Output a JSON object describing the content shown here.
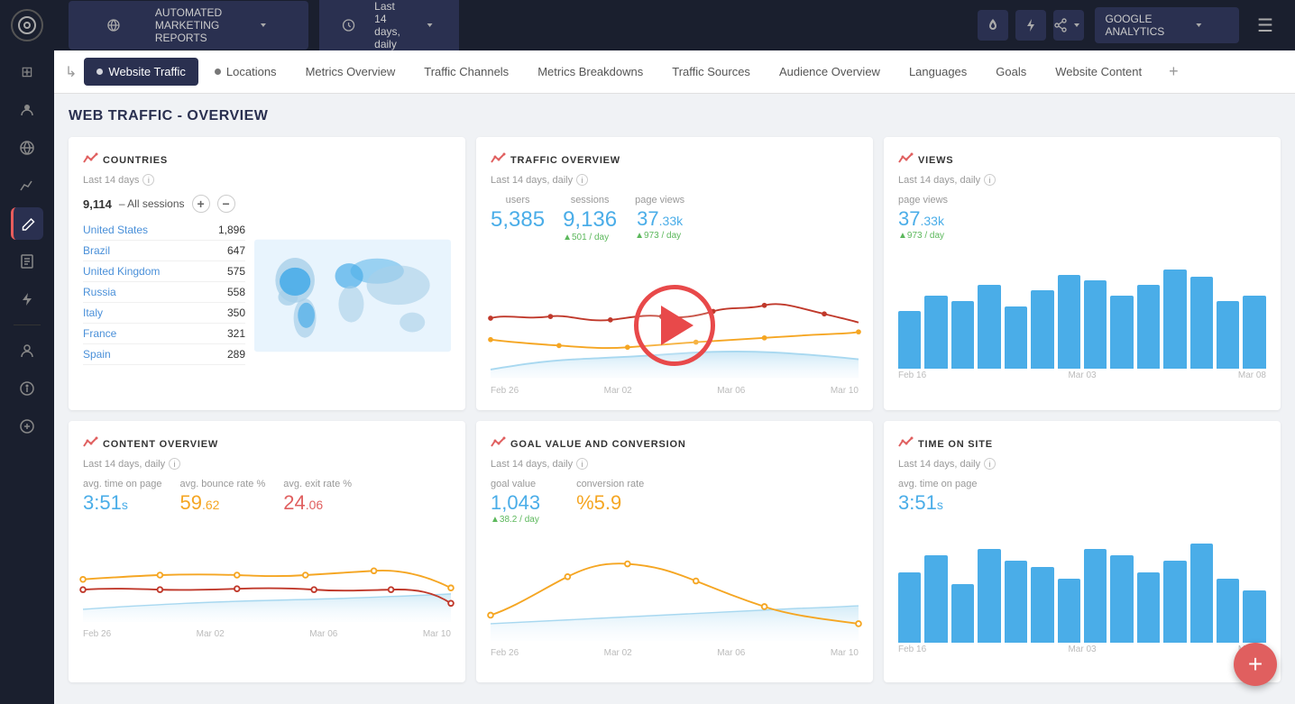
{
  "sidebar": {
    "logo": "○",
    "icons": [
      {
        "name": "home-icon",
        "symbol": "⊞"
      },
      {
        "name": "people-icon",
        "symbol": "👤"
      },
      {
        "name": "globe-icon",
        "symbol": "⊕"
      },
      {
        "name": "graph-icon",
        "symbol": "⌇"
      },
      {
        "name": "pen-icon",
        "symbol": "✏"
      },
      {
        "name": "list-icon",
        "symbol": "≡"
      },
      {
        "name": "lightning-icon",
        "symbol": "⚡"
      },
      {
        "name": "person-icon",
        "symbol": "◯"
      },
      {
        "name": "info-icon",
        "symbol": "ℹ"
      },
      {
        "name": "currency-icon",
        "symbol": "₿"
      }
    ]
  },
  "topbar": {
    "report_label": "AUTOMATED MARKETING REPORTS",
    "date_label": "Last 14 days, daily",
    "analytics_label": "GOOGLE ANALYTICS",
    "fire_icon": "🔥",
    "lightning_icon": "⚡",
    "share_icon": "⇪"
  },
  "tabs": {
    "items": [
      {
        "label": "Website Traffic",
        "active": true,
        "dot": true
      },
      {
        "label": "Locations",
        "active": false,
        "dot": true
      },
      {
        "label": "Metrics Overview",
        "active": false,
        "dot": false
      },
      {
        "label": "Traffic Channels",
        "active": false,
        "dot": false
      },
      {
        "label": "Metrics Breakdowns",
        "active": false,
        "dot": false
      },
      {
        "label": "Traffic Sources",
        "active": false,
        "dot": false
      },
      {
        "label": "Audience Overview",
        "active": false,
        "dot": false
      },
      {
        "label": "Languages",
        "active": false,
        "dot": false
      },
      {
        "label": "Goals",
        "active": false,
        "dot": false
      },
      {
        "label": "Website Content",
        "active": false,
        "dot": false
      }
    ]
  },
  "page": {
    "title": "WEB TRAFFIC - OVERVIEW"
  },
  "countries_card": {
    "title": "COUNTRIES",
    "subtitle": "Last 14 days",
    "total_label": "9,114",
    "total_suffix": "– All sessions",
    "countries": [
      {
        "name": "United States",
        "value": "1,896"
      },
      {
        "name": "Brazil",
        "value": "647"
      },
      {
        "name": "United Kingdom",
        "value": "575"
      },
      {
        "name": "Russia",
        "value": "558"
      },
      {
        "name": "Italy",
        "value": "350"
      },
      {
        "name": "France",
        "value": "321"
      },
      {
        "name": "Spain",
        "value": "289"
      }
    ]
  },
  "traffic_overview_card": {
    "title": "TRAFFIC OVERVIEW",
    "subtitle": "Last 14 days, daily",
    "metrics": [
      {
        "label": "users",
        "value_main": "5,385",
        "sub": null
      },
      {
        "label": "sessions",
        "value_main": "9,136",
        "sub": "▲501 / day"
      },
      {
        "label": "page views",
        "value_main": "37",
        "value_dec": ".33k",
        "sub": "▲973 / day"
      }
    ],
    "axis": [
      "Feb 26",
      "Mar 02",
      "Mar 06",
      "Mar 10"
    ]
  },
  "views_card": {
    "title": "VIEWS",
    "subtitle": "Last 14 days, daily",
    "metric_label": "page views",
    "metric_value_main": "37",
    "metric_value_dec": ".33k",
    "metric_sub": "▲973 / day",
    "bars": [
      55,
      70,
      65,
      80,
      60,
      75,
      90,
      85,
      70,
      80,
      95,
      88,
      65,
      70
    ],
    "axis": [
      "Feb 16",
      "Mar 03",
      "Mar 08"
    ]
  },
  "content_overview_card": {
    "title": "CONTENT OVERVIEW",
    "subtitle": "Last 14 days, daily",
    "metrics": [
      {
        "label": "avg. time on page",
        "value": "3:51",
        "suffix": "s",
        "color": "blue"
      },
      {
        "label": "avg. bounce rate %",
        "value": "59",
        "dec": ".62",
        "color": "orange"
      },
      {
        "label": "avg. exit rate %",
        "value": "24",
        "dec": ".06",
        "color": "red"
      }
    ],
    "axis": [
      "Feb 26",
      "Mar 02",
      "Mar 06",
      "Mar 10"
    ]
  },
  "goal_value_card": {
    "title": "GOAL VALUE AND CONVERSION",
    "subtitle": "Last 14 days, daily",
    "metrics": [
      {
        "label": "goal value",
        "value": "1,043",
        "sub": "▲38.2 / day",
        "color": "blue"
      },
      {
        "label": "conversion rate",
        "prefix": "%",
        "value": "5.9",
        "color": "orange"
      }
    ],
    "axis": [
      "Feb 26",
      "Mar 02",
      "Mar 06",
      "Mar 10"
    ]
  },
  "time_on_site_card": {
    "title": "TIME ON SITE",
    "subtitle": "Last 14 days, daily",
    "metric_label": "avg. time on page",
    "metric_value": "3:51",
    "metric_suffix": "s",
    "bars": [
      60,
      75,
      50,
      80,
      70,
      65,
      55,
      80,
      75,
      60,
      70,
      85,
      55,
      45
    ],
    "axis": [
      "Feb 16",
      "Mar 03",
      "Mar 08"
    ]
  },
  "fab": {
    "label": "+"
  }
}
